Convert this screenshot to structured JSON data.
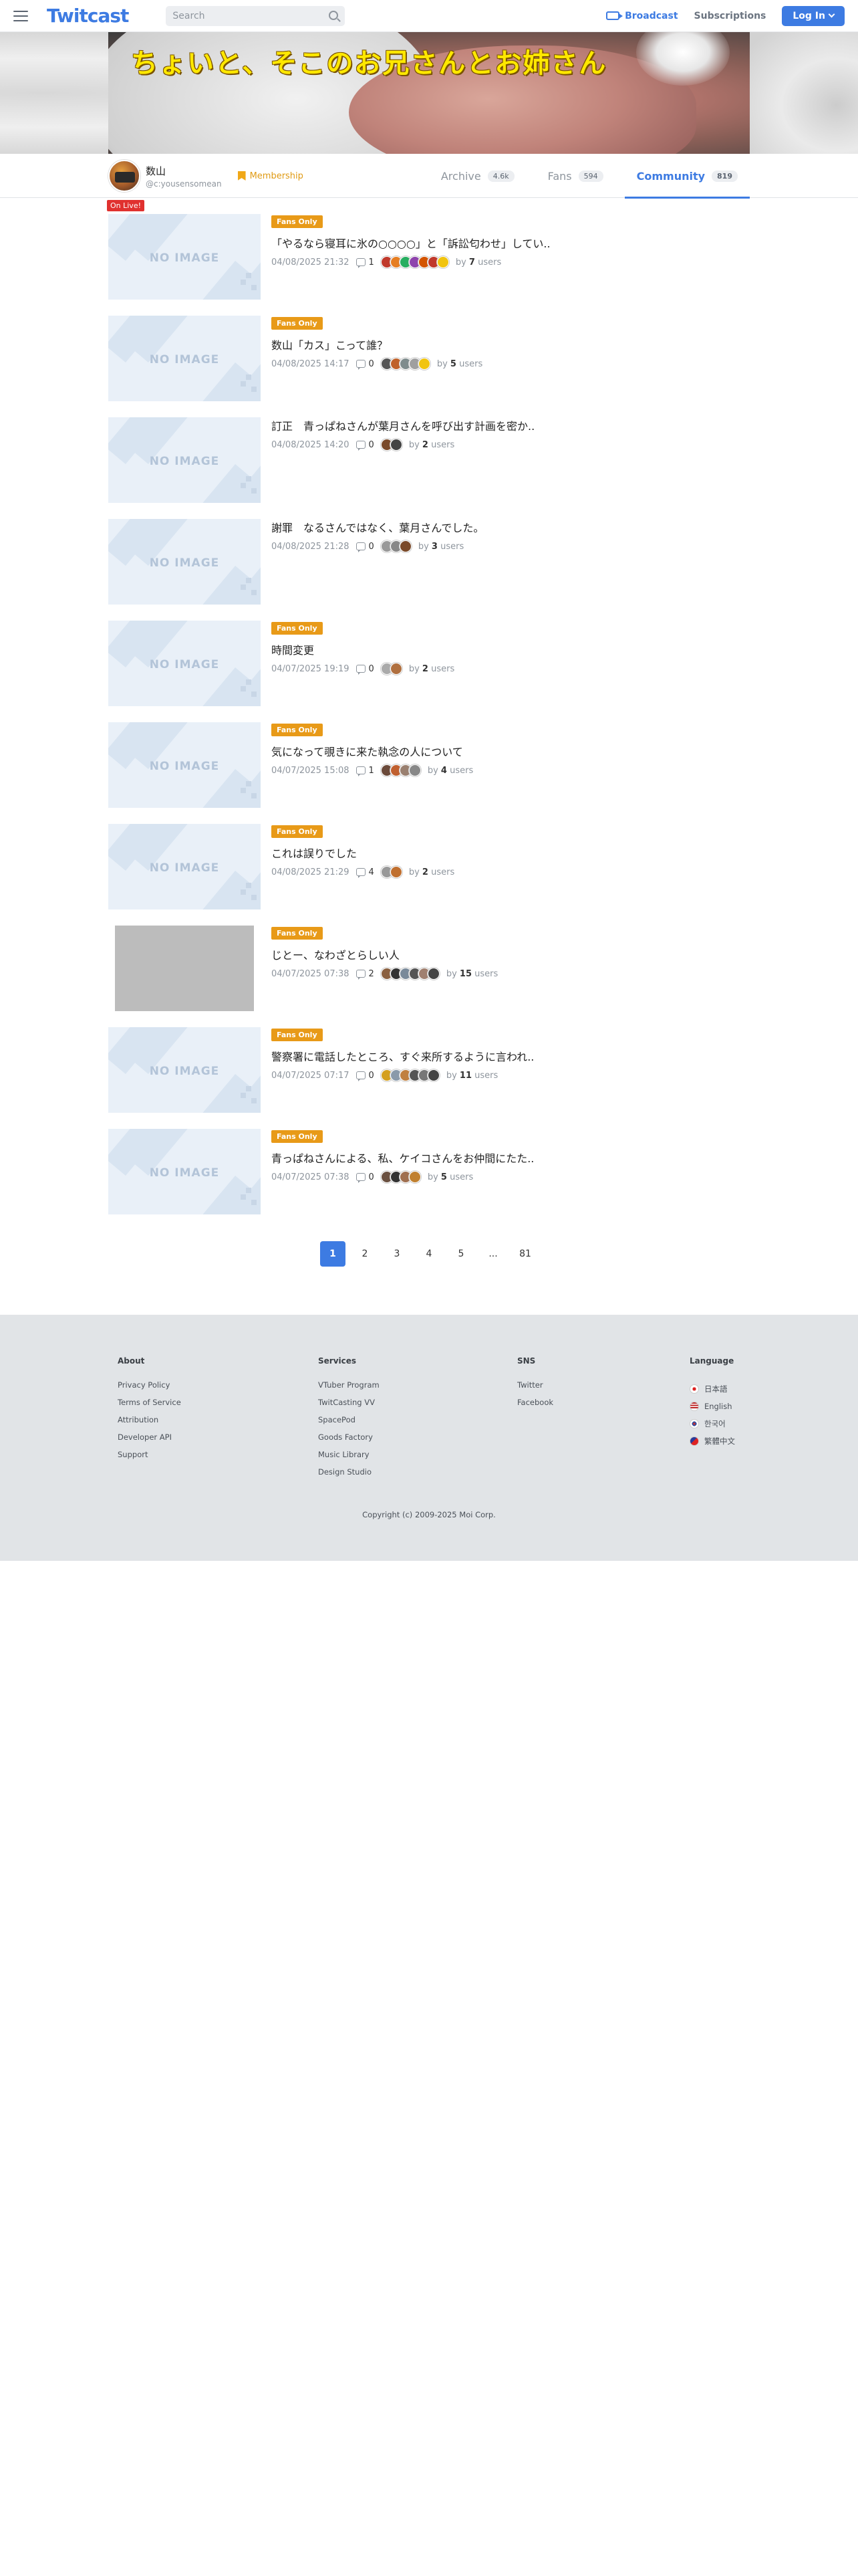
{
  "header": {
    "logo": "Twitcast",
    "search_placeholder": "Search",
    "broadcast": "Broadcast",
    "subscriptions": "Subscriptions",
    "login": "Log In"
  },
  "banner": {
    "title": "ちょいと、そこのお兄さんとお姉さん"
  },
  "profile": {
    "name": "数山",
    "handle": "@c:yousensomean",
    "live_badge": "On Live!",
    "membership": "Membership",
    "tabs": [
      {
        "label": "Archive",
        "count": "4.6k"
      },
      {
        "label": "Fans",
        "count": "594"
      },
      {
        "label": "Community",
        "count": "819"
      }
    ]
  },
  "posts": [
    {
      "badge": "Fans Only",
      "title": "「やるなら寝耳に氷の○○○○」と「訴訟匂わせ」してい..",
      "date": "04/08/2025 21:32",
      "comments": "1",
      "users": "7",
      "users_suffix": "users",
      "thumb": "NO IMAGE"
    },
    {
      "badge": "Fans Only",
      "title": "数山「カス」こって誰？",
      "date": "04/08/2025 14:17",
      "comments": "0",
      "users": "5",
      "users_suffix": "users",
      "thumb": "NO IMAGE"
    },
    {
      "badge": "",
      "title": "訂正　青っぱねさんが葉月さんを呼び出す計画を密か..",
      "date": "04/08/2025 14:20",
      "comments": "0",
      "users": "2",
      "users_suffix": "users",
      "thumb": "NO IMAGE"
    },
    {
      "badge": "",
      "title": "謝罪　なるさんではなく、葉月さんでした。",
      "date": "04/08/2025 21:28",
      "comments": "0",
      "users": "3",
      "users_suffix": "users",
      "thumb": "NO IMAGE"
    },
    {
      "badge": "Fans Only",
      "title": "時間変更",
      "date": "04/07/2025 19:19",
      "comments": "0",
      "users": "2",
      "users_suffix": "users",
      "thumb": "NO IMAGE"
    },
    {
      "badge": "Fans Only",
      "title": "気になって覗きに来た執念の人について",
      "date": "04/07/2025 15:08",
      "comments": "1",
      "users": "4",
      "users_suffix": "users",
      "thumb": "NO IMAGE"
    },
    {
      "badge": "Fans Only",
      "title": "これは誤りでした",
      "date": "04/08/2025 21:29",
      "comments": "4",
      "users": "2",
      "users_suffix": "users",
      "thumb": "NO IMAGE"
    },
    {
      "badge": "Fans Only",
      "title": "じとー、なわざとらしい人",
      "date": "04/07/2025 07:38",
      "comments": "2",
      "users": "15",
      "users_suffix": "users",
      "thumb": ""
    },
    {
      "badge": "Fans Only",
      "title": "警察署に電話したところ、すぐ来所するように言われ..",
      "date": "04/07/2025 07:17",
      "comments": "0",
      "users": "11",
      "users_suffix": "users",
      "thumb": "NO IMAGE"
    },
    {
      "badge": "Fans Only",
      "title": "青っぱねさんによる、私、ケイコさんをお仲間にたた..",
      "date": "04/07/2025 07:38",
      "comments": "0",
      "users": "5",
      "users_suffix": "users",
      "thumb": "NO IMAGE"
    }
  ],
  "by_label": "by",
  "pagination": [
    "1",
    "2",
    "3",
    "4",
    "5",
    "...",
    "81"
  ],
  "footer": {
    "about": {
      "title": "About",
      "items": [
        "Privacy Policy",
        "Terms of Service",
        "Attribution",
        "Developer API",
        "Support"
      ]
    },
    "services": {
      "title": "Services",
      "items": [
        "VTuber Program",
        "TwitCasting VV",
        "SpacePod",
        "Goods Factory",
        "Music Library",
        "Design Studio"
      ]
    },
    "sns": {
      "title": "SNS",
      "items": [
        "Twitter",
        "Facebook"
      ]
    },
    "language": {
      "title": "Language",
      "items": [
        "日本語",
        "English",
        "한국어",
        "繁體中文"
      ]
    },
    "copyright": "Copyright (c) 2009-2025 Moi Corp."
  },
  "colors": {
    "accent": "#3d7be2",
    "badge": "#e89a18",
    "live": "#e0312f"
  }
}
